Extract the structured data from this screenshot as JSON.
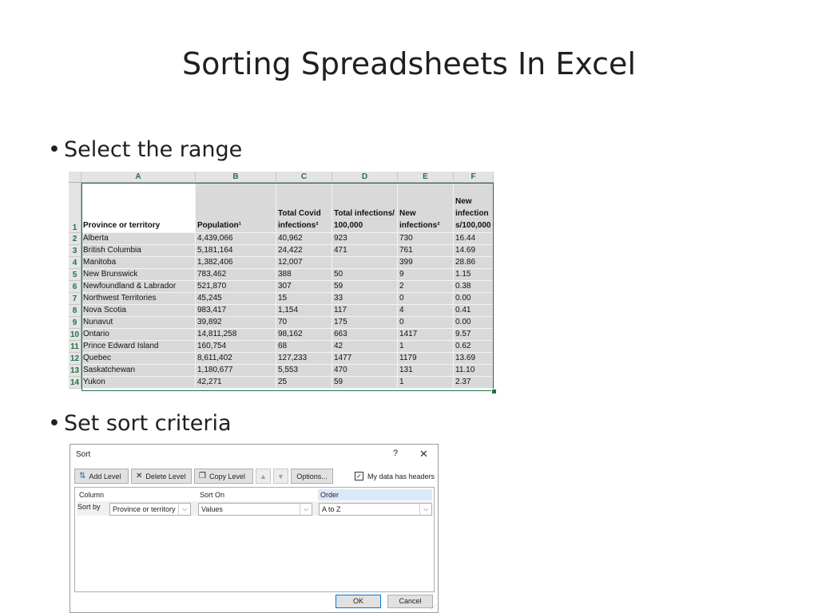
{
  "slide": {
    "title": "Sorting Spreadsheets In Excel",
    "bullets": [
      "Select the range",
      "Set sort criteria"
    ]
  },
  "sheet": {
    "columns": [
      "A",
      "B",
      "C",
      "D",
      "E",
      "F"
    ],
    "header_row_number": "1",
    "headers": [
      "Province or territory",
      "Population¹",
      "Total Covid infections²",
      "Total infections/ 100,000",
      "New infections²",
      "New infection s/100,000"
    ],
    "rows": [
      {
        "num": "2",
        "cells": [
          "Alberta",
          "4,439,066",
          "40,962",
          "923",
          "730",
          "16.44"
        ]
      },
      {
        "num": "3",
        "cells": [
          "British Columbia",
          "5,181,164",
          "24,422",
          "471",
          "761",
          "14.69"
        ]
      },
      {
        "num": "4",
        "cells": [
          "Manitoba",
          "1,382,406",
          "12,007",
          "",
          "399",
          "28.86"
        ]
      },
      {
        "num": "5",
        "cells": [
          "New Brunswick",
          "783,462",
          "388",
          "50",
          "9",
          "1.15"
        ]
      },
      {
        "num": "6",
        "cells": [
          "Newfoundland & Labrador",
          "521,870",
          "307",
          "59",
          "2",
          "0.38"
        ]
      },
      {
        "num": "7",
        "cells": [
          "Northwest Territories",
          "45,245",
          "15",
          "33",
          "0",
          "0.00"
        ]
      },
      {
        "num": "8",
        "cells": [
          "Nova Scotia",
          "983,417",
          "1,154",
          "117",
          "4",
          "0.41"
        ]
      },
      {
        "num": "9",
        "cells": [
          "Nunavut",
          "39,892",
          "70",
          "175",
          "0",
          "0.00"
        ]
      },
      {
        "num": "10",
        "cells": [
          "Ontario",
          "14,811,258",
          "98,162",
          "663",
          "1417",
          "9.57"
        ]
      },
      {
        "num": "11",
        "cells": [
          "Prince Edward Island",
          "160,754",
          "68",
          "42",
          "1",
          "0.62"
        ]
      },
      {
        "num": "12",
        "cells": [
          "Quebec",
          "8,611,402",
          "127,233",
          "1477",
          "1179",
          "13.69"
        ]
      },
      {
        "num": "13",
        "cells": [
          "Saskatchewan",
          "1,180,677",
          "5,553",
          "470",
          "131",
          "11.10"
        ]
      },
      {
        "num": "14",
        "cells": [
          "Yukon",
          "42,271",
          "25",
          "59",
          "1",
          "2.37"
        ]
      }
    ],
    "accent_color": "#217346"
  },
  "dialog": {
    "title": "Sort",
    "help": "?",
    "close": "✕",
    "toolbar": {
      "add_level": "Add Level",
      "delete_level": "Delete Level",
      "copy_level": "Copy Level",
      "move_up": "▲",
      "move_down": "▼",
      "options": "Options..."
    },
    "my_data_has_headers": "My data has headers",
    "checkbox_mark": "✓",
    "grid": {
      "column_header": "Column",
      "sort_on_header": "Sort On",
      "order_header": "Order",
      "sort_by_label": "Sort by",
      "column_value": "Province or territory",
      "sort_on_value": "Values",
      "order_value": "A to Z"
    },
    "ok": "OK",
    "cancel": "Cancel"
  }
}
